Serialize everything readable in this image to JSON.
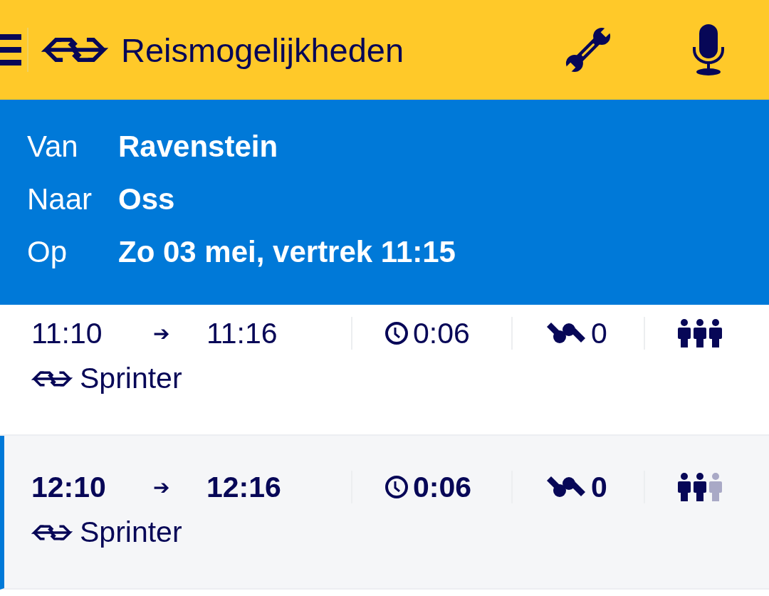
{
  "header": {
    "title": "Reismogelijkheden"
  },
  "route": [
    {
      "label": "Van",
      "value": "Ravenstein"
    },
    {
      "label": "Naar",
      "value": "Oss"
    },
    {
      "label": "Op",
      "value": "Zo 03 mei, vertrek 11:15"
    }
  ],
  "trips": [
    {
      "departure": "11:10",
      "arrow": "➔",
      "arrival": "11:16",
      "duration": "0:06",
      "transfers": "0",
      "crowding": [
        {
          "filled": true
        },
        {
          "filled": true
        },
        {
          "filled": true
        }
      ],
      "train": "Sprinter",
      "selected": false
    },
    {
      "departure": "12:10",
      "arrow": "➔",
      "arrival": "12:16",
      "duration": "0:06",
      "transfers": "0",
      "crowding": [
        {
          "filled": true
        },
        {
          "filled": true
        },
        {
          "filled": false
        }
      ],
      "train": "Sprinter",
      "selected": true
    }
  ]
}
